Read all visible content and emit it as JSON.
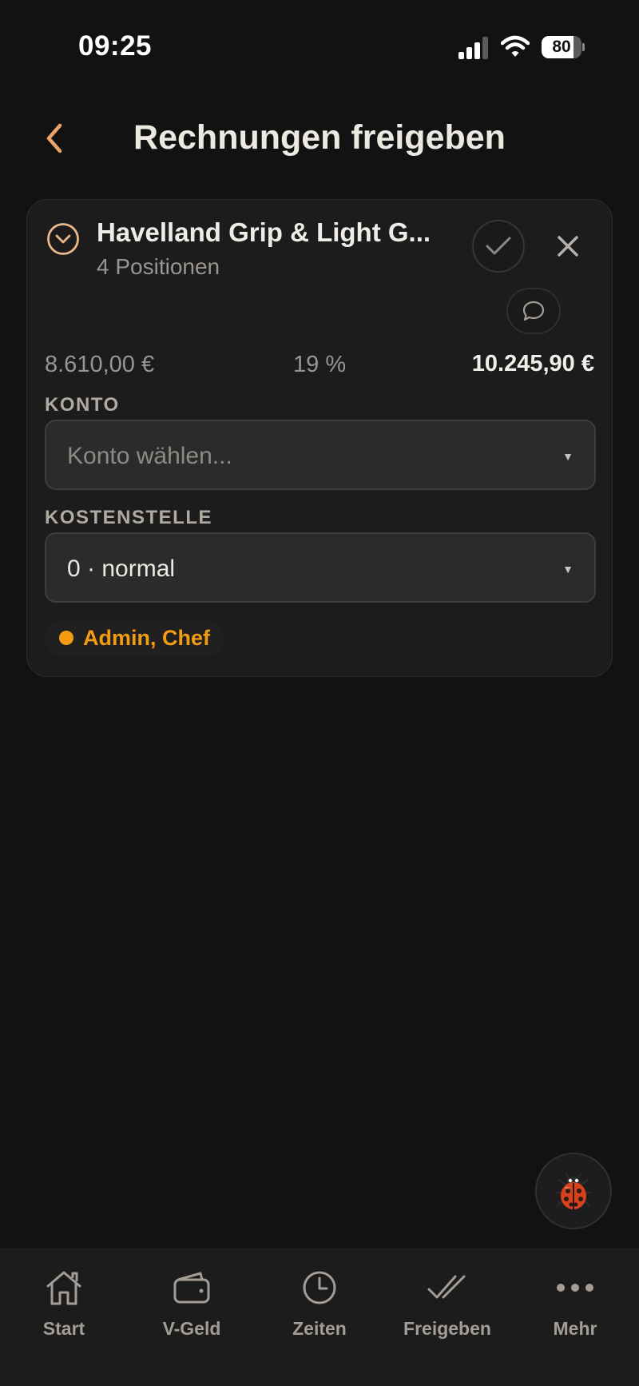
{
  "status_bar": {
    "time": "09:25",
    "battery_level": "80",
    "battery_fraction": 0.8
  },
  "header": {
    "title": "Rechnungen freigeben"
  },
  "invoice": {
    "vendor": "Havelland Grip & Light G...",
    "positions": "4 Positionen",
    "net_amount": "8.610,00 €",
    "vat_rate": "19 %",
    "gross_amount": "10.245,90 €",
    "konto": {
      "label": "KONTO",
      "placeholder": "Konto wählen..."
    },
    "kostenstelle": {
      "label": "KOSTENSTELLE",
      "value": "0 · normal"
    },
    "approvers": "Admin, Chef"
  },
  "colors": {
    "background": "#121212",
    "card": "#1c1c1c",
    "accent": "#e8a26a",
    "approver": "#f39c12"
  },
  "tabs": [
    {
      "label": "Start",
      "icon": "home-icon"
    },
    {
      "label": "V-Geld",
      "icon": "wallet-icon"
    },
    {
      "label": "Zeiten",
      "icon": "clock-icon"
    },
    {
      "label": "Freigeben",
      "icon": "double-check-icon"
    },
    {
      "label": "Mehr",
      "icon": "more-icon"
    }
  ]
}
